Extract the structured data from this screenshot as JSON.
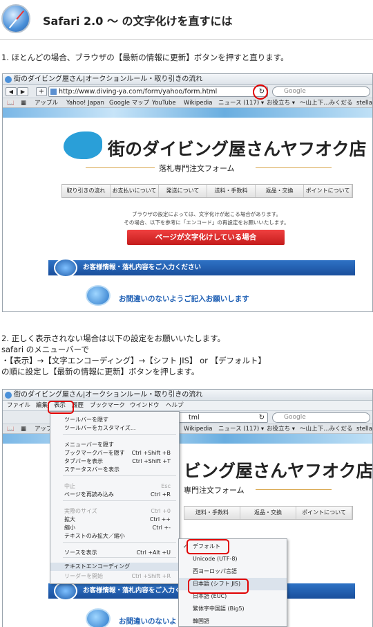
{
  "header": {
    "title": "Safari 2.0 〜 の文字化けを直すには"
  },
  "step1": {
    "text": "1. ほとんどの場合、ブラウザの【最新の情報に更新】ボタンを押すと直ります。"
  },
  "step2": {
    "line1": "2. 正しく表示されない場合は以下の設定をお願いいたします。",
    "line2": "safari のメニューバーで",
    "line3": "・【表示】→【文字エンコーディング】→【シフト JIS】 or 【デフォルト】",
    "line4": "の順に設定し【最新の情報に更新】ボタンを押します。"
  },
  "browser": {
    "window_title": "街のダイビング屋さん|オークションルール・取り引きの流れ",
    "url": "http://www.diving-ya.com/form/yahoo/form.html",
    "url_short": "tml",
    "search_placeholder": "Google",
    "nav_back": "◀",
    "nav_fwd": "▶",
    "add": "+",
    "reload_icon": "↻",
    "bookmarks": [
      "アップル",
      "Yahoo! Japan",
      "Google マップ",
      "YouTube",
      "Wikipedia",
      "ニュース (117) ▾",
      "お役立ち ▾",
      "〜山上下…みくだる",
      "stella"
    ],
    "bookmarks_short": [
      "アップル",
      "Wikipedia",
      "ニュース (117) ▾",
      "お役立ち ▾",
      "〜山上下…みくだる",
      "stella"
    ]
  },
  "site": {
    "logo": "街のダイビング屋さんヤフオク店",
    "logo_partial": "ビング屋さんヤフオク店",
    "subtitle": "落札専門注文フォーム",
    "subtitle_partial": "専門注文フォーム",
    "nav": [
      "取り引きの流れ",
      "お支払いについて",
      "発送について",
      "送料・手数料",
      "返品・交換",
      "ポイントについて"
    ],
    "nav_partial": [
      "送料・手数料",
      "返品・交換",
      "ポイントについて"
    ],
    "notice_line1": "ブラウザの設定によっては、文字化けが起こる場合があります。",
    "notice_line2": "その場合、以下を参考に「エンコード」の再設定をお願いいたします。",
    "red_button": "ページが文字化けしている場合",
    "band": "お客様情報・落札内容をご入力ください",
    "question": "お間違いのないようご記入お願いします",
    "question_partial": "お間違いのないよ"
  },
  "menubar": [
    "ファイル",
    "編集",
    "表示",
    "履歴",
    "ブックマーク",
    "ウインドウ",
    "ヘルプ"
  ],
  "view_menu": [
    {
      "label": "ツールバーを隠す",
      "shortcut": ""
    },
    {
      "label": "ツールバーをカスタマイズ...",
      "shortcut": ""
    },
    {
      "label": "メニューバーを隠す",
      "shortcut": ""
    },
    {
      "label": "ブックマークバーを隠す",
      "shortcut": "Ctrl +Shift +B"
    },
    {
      "label": "タブバーを表示",
      "shortcut": "Ctrl +Shift +T"
    },
    {
      "label": "ステータスバーを表示",
      "shortcut": ""
    },
    {
      "label": "中止",
      "shortcut": "Esc"
    },
    {
      "label": "ページを再読み込み",
      "shortcut": "Ctrl +R"
    },
    {
      "label": "実際のサイズ",
      "shortcut": "Ctrl +0"
    },
    {
      "label": "拡大",
      "shortcut": "Ctrl ++"
    },
    {
      "label": "縮小",
      "shortcut": "Ctrl +-"
    },
    {
      "label": "テキストのみ拡大／縮小",
      "shortcut": ""
    },
    {
      "label": "ソースを表示",
      "shortcut": "Ctrl +Alt +U"
    },
    {
      "label": "テキストエンコーディング",
      "shortcut": ""
    },
    {
      "label": "リーダーを開始",
      "shortcut": "Ctrl +Shift +R"
    }
  ],
  "encoding_menu": [
    {
      "label": "デフォルト",
      "check": "✓"
    },
    {
      "label": "Unicode (UTF-8)",
      "check": ""
    },
    {
      "label": "西ヨーロッパ言語",
      "check": ""
    },
    {
      "label": "日本語 (シフト JIS)",
      "check": ""
    },
    {
      "label": "日本語 (EUC)",
      "check": ""
    },
    {
      "label": "繁体字中国語 (Big5)",
      "check": ""
    },
    {
      "label": "韓国語",
      "check": ""
    }
  ],
  "colors": {
    "accent_red": "#e00000",
    "safari_blue": "#4a90d9",
    "band_blue": "#1a4f9c"
  }
}
